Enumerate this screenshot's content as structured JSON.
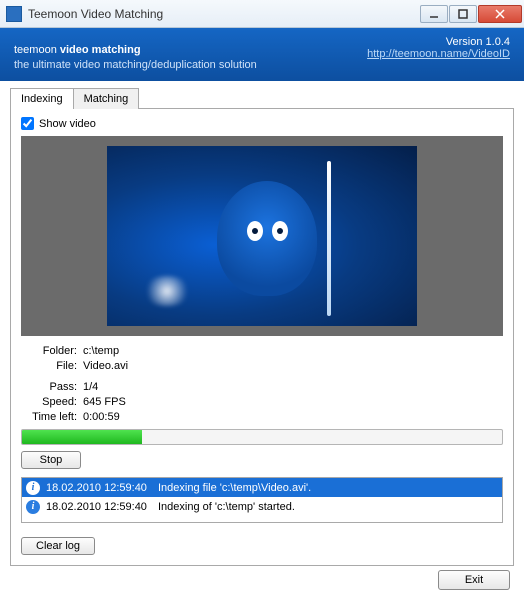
{
  "window": {
    "title": "Teemoon Video Matching"
  },
  "banner": {
    "brand_light": "teemoon ",
    "brand_bold": "video matching",
    "tagline": "the ultimate video matching/deduplication solution",
    "version": "Version 1.0.4",
    "link": "http://teemoon.name/VideoID"
  },
  "tabs": {
    "indexing": "Indexing",
    "matching": "Matching"
  },
  "show_video_label": "Show video",
  "info": {
    "folder_lbl": "Folder:",
    "folder_val": "c:\\temp",
    "file_lbl": "File:",
    "file_val": "Video.avi",
    "pass_lbl": "Pass:",
    "pass_val": "1/4",
    "speed_lbl": "Speed:",
    "speed_val": "645 FPS",
    "timeleft_lbl": "Time left:",
    "timeleft_val": "0:00:59"
  },
  "progress_percent": 25,
  "buttons": {
    "stop": "Stop",
    "clear_log": "Clear log",
    "exit": "Exit"
  },
  "log": [
    {
      "ts": "18.02.2010 12:59:40",
      "msg": "Indexing file 'c:\\temp\\Video.avi'.",
      "selected": true
    },
    {
      "ts": "18.02.2010 12:59:40",
      "msg": "Indexing of 'c:\\temp' started.",
      "selected": false
    }
  ]
}
